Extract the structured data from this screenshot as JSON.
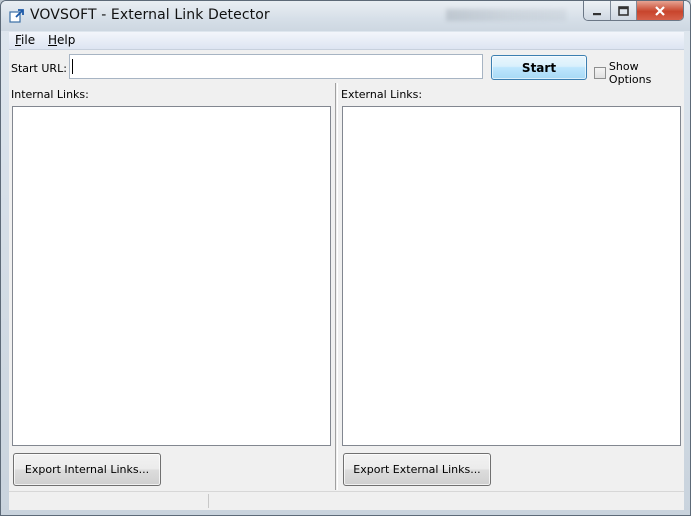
{
  "window": {
    "title": "VOVSOFT - External Link Detector",
    "accent_close": "#c8452c"
  },
  "menu": {
    "file": {
      "mnemonic": "F",
      "rest": "ile"
    },
    "help": {
      "mnemonic": "H",
      "rest": "elp"
    }
  },
  "toolbar": {
    "start_url_label": "Start URL:",
    "url_value": "",
    "start_label": "Start",
    "show_options_label": "Show Options",
    "show_options_checked": false
  },
  "internal": {
    "label": "Internal Links:",
    "items": [],
    "export_label": "Export Internal Links..."
  },
  "external": {
    "label": "External Links:",
    "items": [],
    "export_label": "Export External Links..."
  },
  "icons": {
    "app": "external-link-icon",
    "minimize": "minimize-icon",
    "maximize": "maximize-icon",
    "close": "close-icon"
  }
}
